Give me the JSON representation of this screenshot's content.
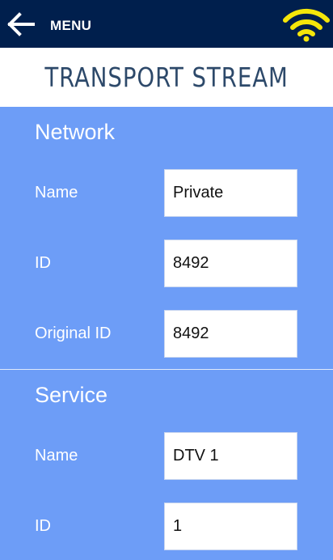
{
  "topbar": {
    "menu_label": "MENU",
    "icons": {
      "back": "arrow-left-icon",
      "signal": "wifi-icon"
    },
    "colors": {
      "background": "#001f4d",
      "wifi": "#f5e60a"
    }
  },
  "page": {
    "title": "TRANSPORT STREAM",
    "background": "#6d9df7"
  },
  "network": {
    "section_title": "Network",
    "name_label": "Name",
    "name_value": "Private",
    "id_label": "ID",
    "id_value": "8492",
    "original_id_label": "Original ID",
    "original_id_value": "8492"
  },
  "service": {
    "section_title": "Service",
    "name_label": "Name",
    "name_value": "DTV 1",
    "id_label": "ID",
    "id_value": "1"
  }
}
